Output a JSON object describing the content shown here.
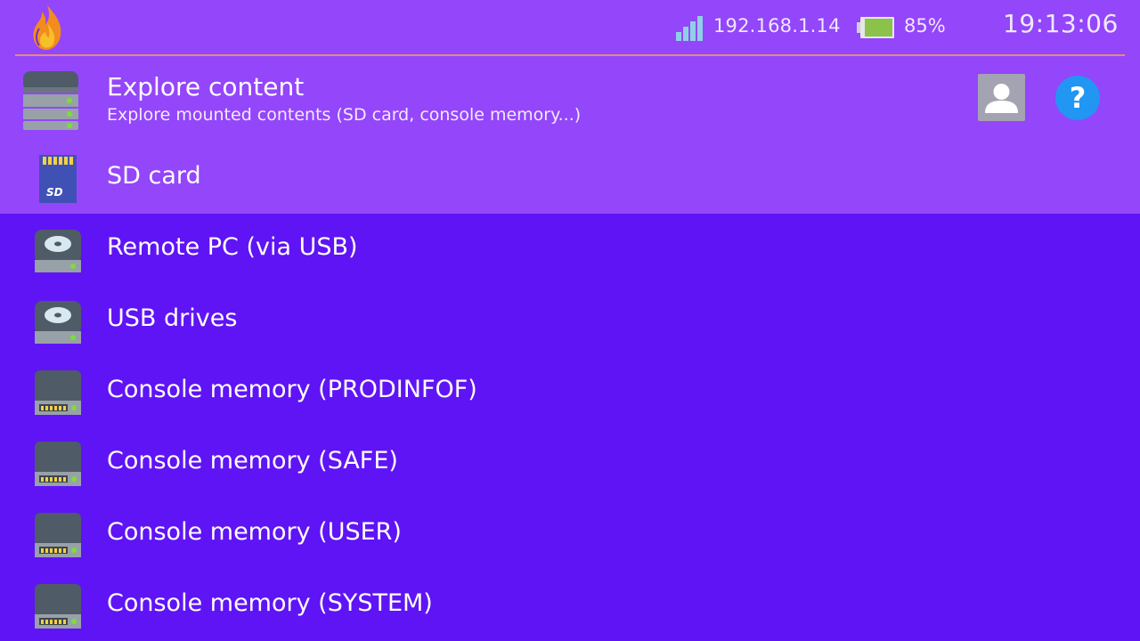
{
  "status_bar": {
    "ip_address": "192.168.1.14",
    "battery_percent": "85%",
    "battery_level": 0.85,
    "time": "19:13:06"
  },
  "header": {
    "title": "Explore content",
    "subtitle": "Explore mounted contents (SD card, console memory...)",
    "help_label": "?"
  },
  "list": {
    "items": [
      {
        "label": "SD card",
        "icon": "sd-card-icon",
        "selected": true
      },
      {
        "label": "Remote PC (via USB)",
        "icon": "disk-drive-icon",
        "selected": false
      },
      {
        "label": "USB drives",
        "icon": "disk-drive-icon",
        "selected": false
      },
      {
        "label": "Console memory (PRODINFOF)",
        "icon": "memory-chip-icon",
        "selected": false
      },
      {
        "label": "Console memory (SAFE)",
        "icon": "memory-chip-icon",
        "selected": false
      },
      {
        "label": "Console memory (USER)",
        "icon": "memory-chip-icon",
        "selected": false
      },
      {
        "label": "Console memory (SYSTEM)",
        "icon": "memory-chip-icon",
        "selected": false
      }
    ]
  },
  "colors": {
    "background": "#5f14f5",
    "header_background": "#9446fa",
    "selected_row": "#9446fa",
    "divider": "#e58b7e",
    "help_button": "#2196f3",
    "battery_fill": "#8bc34a"
  }
}
